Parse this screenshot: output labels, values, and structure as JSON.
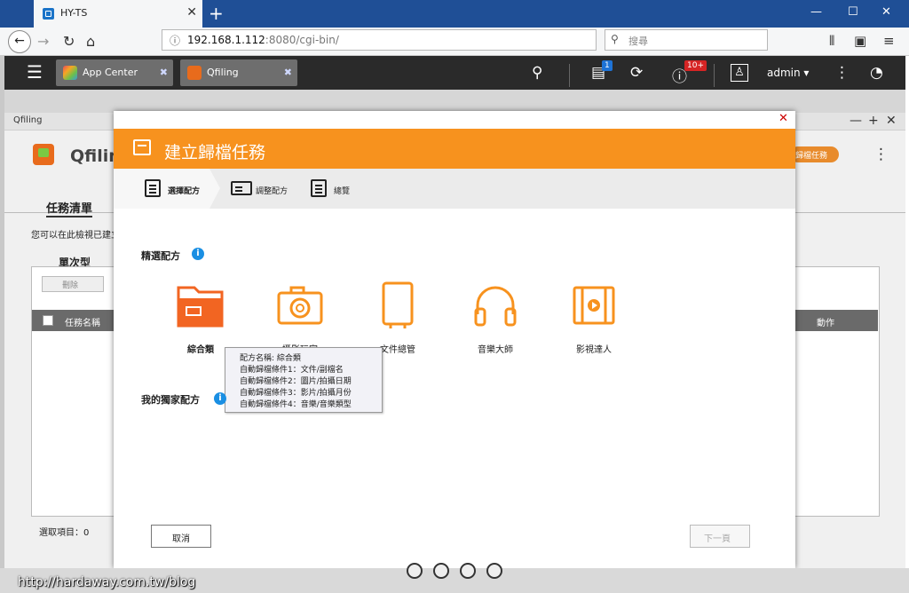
{
  "browser": {
    "tab_title": "HY-TS",
    "tab_close": "✕",
    "new_tab": "+",
    "url_host": "192.168.1.112",
    "url_rest": ":8080/cgi-bin/",
    "search_placeholder": "搜尋"
  },
  "qts": {
    "app_tabs": [
      {
        "label": "App Center"
      },
      {
        "label": "Qfiling"
      }
    ],
    "notif_badge": "1",
    "info_badge": "10+",
    "user": "admin ▾"
  },
  "qfiling": {
    "window_title": "Qfiling",
    "app_name": "Qfilin",
    "orange_button": "歸檔任務",
    "task_list_title": "任務清單",
    "description": "您可以在此檢視已建立",
    "single_type_title": "單次型",
    "delete_button": "刪除",
    "col_task_name": "任務名稱",
    "col_action": "動作",
    "selected_items": "選取項目：0"
  },
  "modal": {
    "title": "建立歸檔任務",
    "steps": [
      {
        "label": "選擇配方"
      },
      {
        "label": "調整配方"
      },
      {
        "label": "總覽"
      }
    ],
    "featured_title": "精選配方",
    "my_title": "我的獨家配方",
    "recipes": [
      {
        "label": "綜合類"
      },
      {
        "label": "攝影玩家"
      },
      {
        "label": "文件總管"
      },
      {
        "label": "音樂大師"
      },
      {
        "label": "影視達人"
      }
    ],
    "tooltip": [
      "配方名稱: 綜合類",
      "自動歸檔條件1：文件/副檔名",
      "自動歸檔條件2：圖片/拍攝日期",
      "自動歸檔條件3：影片/拍攝月份",
      "自動歸檔條件4：音樂/音樂類型"
    ],
    "cancel": "取消",
    "next": "下一頁"
  },
  "watermark": "http://hardaway.com.tw/blog",
  "colors": {
    "accent": "#f7921e",
    "titlebar": "#1f4f96",
    "qts_bar": "#2a2a2a"
  }
}
